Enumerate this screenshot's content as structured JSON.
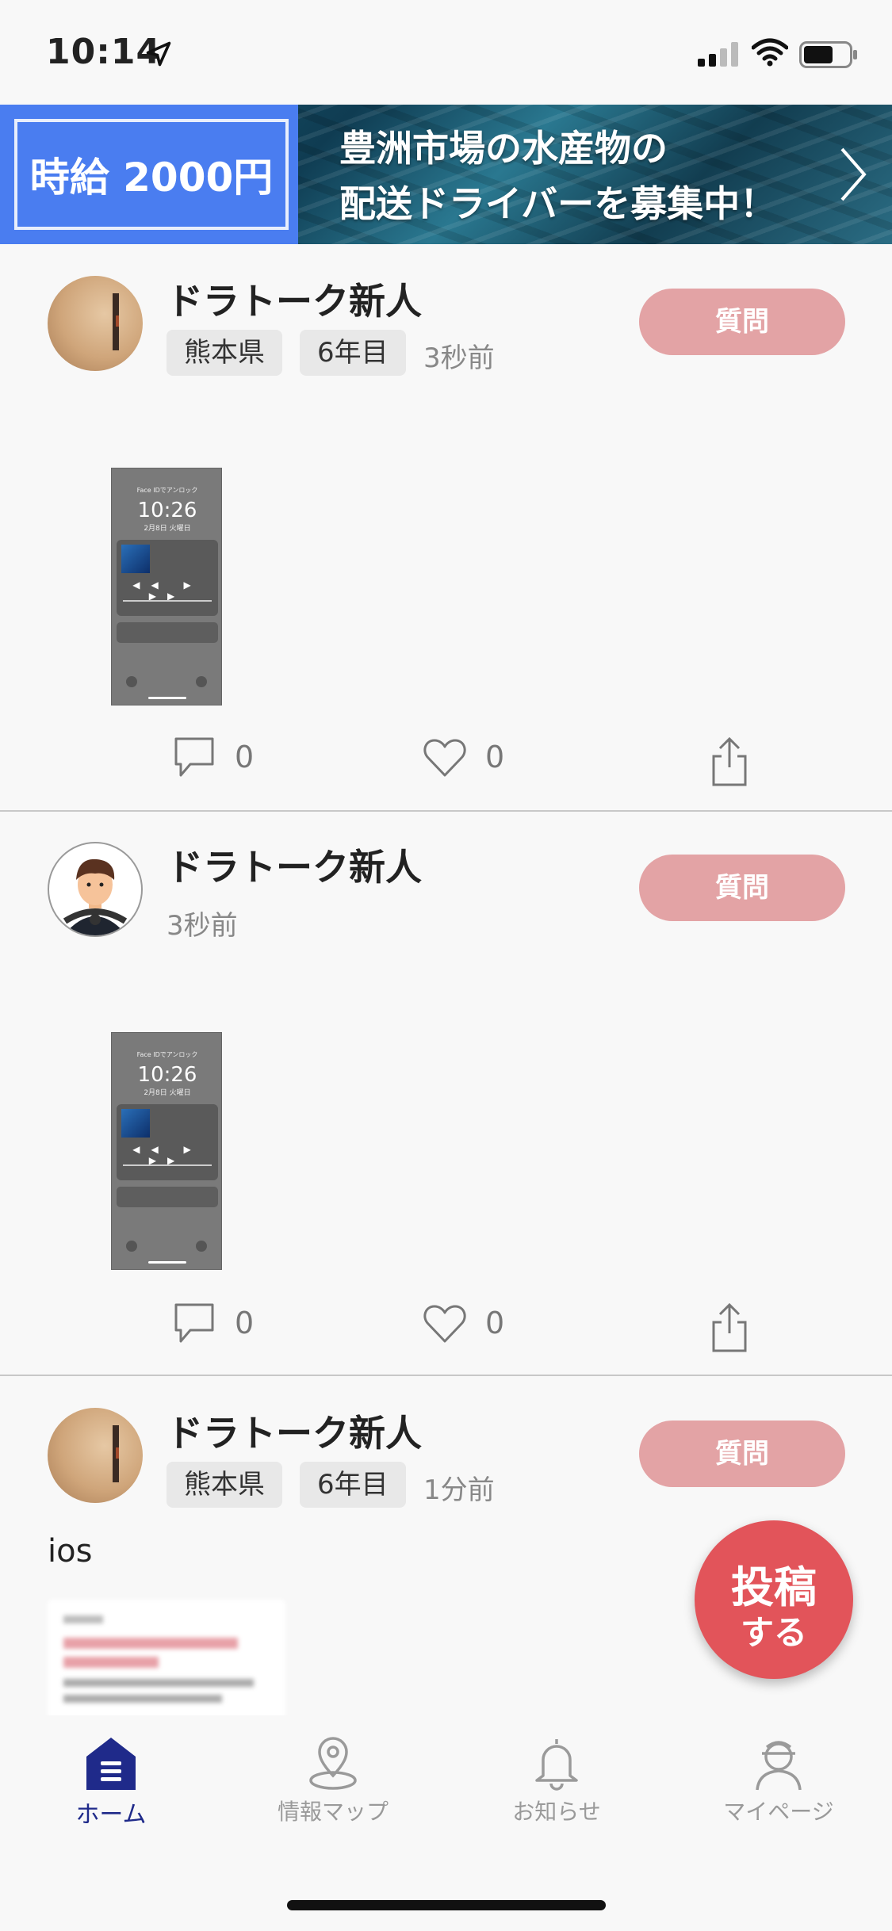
{
  "status_bar": {
    "time": "10:14"
  },
  "banner": {
    "wage_text": "時給 2000円",
    "line1": "豊洲市場の水産物の",
    "line2": "配送ドライバーを募集中！",
    "next_icon": "chevron-right-icon"
  },
  "posts": [
    {
      "username": "ドラトーク新人",
      "prefecture": "熊本県",
      "years": "6年目",
      "time": "3秒前",
      "question_label": "質問",
      "thumb": {
        "time": "10:26",
        "date": "2月8日 火曜日",
        "lock": "Face IDでアンロック"
      },
      "comments": "0",
      "likes": "0"
    },
    {
      "username": "ドラトーク新人",
      "time": "3秒前",
      "question_label": "質問",
      "thumb": {
        "time": "10:26",
        "date": "2月8日 火曜日",
        "lock": "Face IDでアンロック"
      },
      "comments": "0",
      "likes": "0"
    },
    {
      "username": "ドラトーク新人",
      "prefecture": "熊本県",
      "years": "6年目",
      "time": "1分前",
      "question_label": "質問",
      "body": "ios"
    }
  ],
  "fab": {
    "line1": "投稿",
    "line2": "する"
  },
  "tab_bar": {
    "items": [
      {
        "label": "ホーム",
        "icon": "home-icon",
        "active": true
      },
      {
        "label": "情報マップ",
        "icon": "map-pin-icon",
        "active": false
      },
      {
        "label": "お知らせ",
        "icon": "bell-icon",
        "active": false
      },
      {
        "label": "マイページ",
        "icon": "user-icon",
        "active": false
      }
    ]
  },
  "colors": {
    "question_button": "#e3a3a5",
    "fab": "#e2545a",
    "banner_wage_bg": "#4a7df0",
    "tab_active": "#1f2a8a"
  }
}
